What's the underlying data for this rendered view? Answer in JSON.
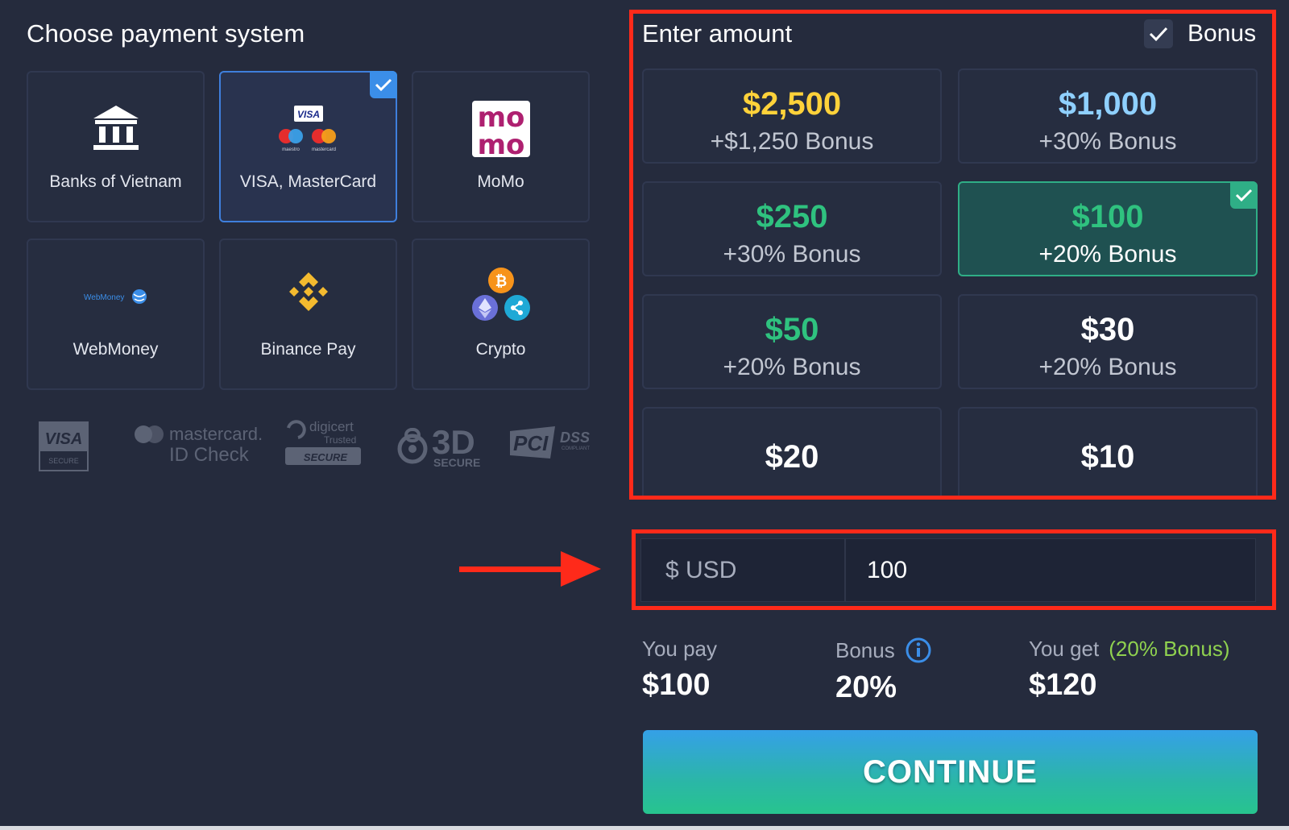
{
  "payment": {
    "title": "Choose payment system",
    "methods": [
      {
        "label": "Banks of Vietnam",
        "icon": "bank-icon"
      },
      {
        "label": "VISA, MasterCard",
        "icon": "visa-mastercard-icon",
        "selected": true
      },
      {
        "label": "MoMo",
        "icon": "momo-logo"
      },
      {
        "label": "WebMoney",
        "icon": "webmoney-logo"
      },
      {
        "label": "Binance Pay",
        "icon": "binance-logo"
      },
      {
        "label": "Crypto",
        "icon": "crypto-icon"
      }
    ],
    "logo_text": {
      "visa_card": "VISA",
      "maestro": "maestro",
      "mastercard_small": "mastercard",
      "momo_line1": "mo",
      "momo_line2": "mo",
      "webmoney": "WebMoney"
    },
    "security_logos": {
      "visa_secure_brand": "VISA",
      "visa_secure_sub": "SECURE",
      "mastercard_brand": "mastercard.",
      "mastercard_sub": "ID Check",
      "digicert_brand": "digicert",
      "digicert_trusted": "Trusted",
      "digicert_secure": "SECURE",
      "three_d": "3D",
      "three_d_sub": "SECURE",
      "pci": "PCI",
      "dss": "DSS",
      "dss_sub": "COMPLIANT"
    }
  },
  "amount": {
    "title": "Enter amount",
    "bonus_toggle_label": "Bonus",
    "bonus_toggle_checked": true,
    "options": [
      {
        "value": "$2,500",
        "bonus": "+$1,250 Bonus",
        "color": "#ffd23a"
      },
      {
        "value": "$1,000",
        "bonus": "+30% Bonus",
        "color": "#8fd0ff"
      },
      {
        "value": "$250",
        "bonus": "+30% Bonus",
        "color": "#2fc27f"
      },
      {
        "value": "$100",
        "bonus": "+20% Bonus",
        "color": "#2fc27f",
        "selected": true
      },
      {
        "value": "$50",
        "bonus": "+20% Bonus",
        "color": "#2fc27f"
      },
      {
        "value": "$30",
        "bonus": "+20% Bonus",
        "color": "#ffffff"
      },
      {
        "value": "$20",
        "bonus": "",
        "color": "#ffffff"
      },
      {
        "value": "$10",
        "bonus": "",
        "color": "#ffffff"
      }
    ],
    "currency": "$ USD",
    "input_value": "100"
  },
  "summary": {
    "you_pay_label": "You pay",
    "you_pay_value": "$100",
    "bonus_label": "Bonus",
    "bonus_value": "20%",
    "you_get_label": "You get",
    "you_get_note": "(20% Bonus)",
    "you_get_value": "$120"
  },
  "continue_label": "CONTINUE",
  "colors": {
    "highlight_red": "#ff2a1a",
    "selected_blue": "#3b8ee8",
    "selected_green": "#2fae86",
    "accent_green": "#8fd14f",
    "info_blue": "#3b8ee8"
  }
}
